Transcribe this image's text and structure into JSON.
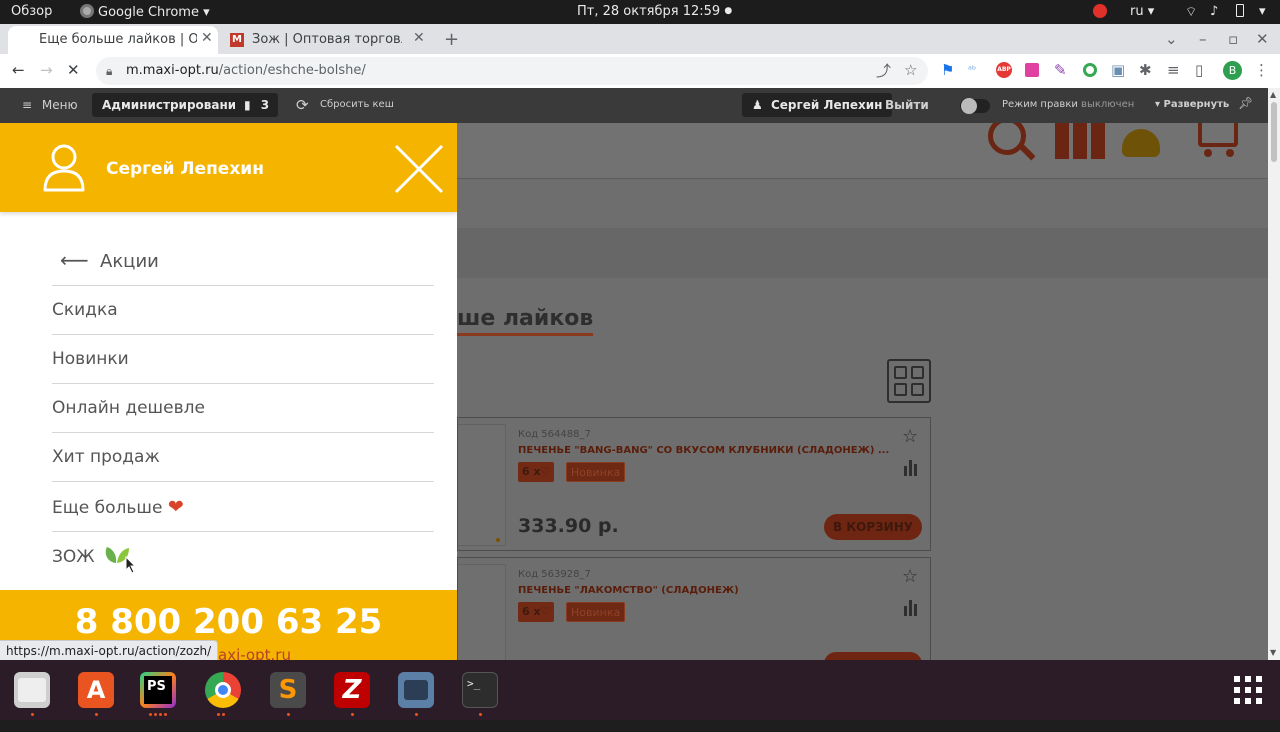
{
  "system": {
    "overview": "Обзор",
    "app": "Google Chrome",
    "datetime": "Пт, 28 октября  12:59",
    "lang": "ru"
  },
  "browser": {
    "tabs": [
      {
        "title": "Еще больше лайков | Оп"
      },
      {
        "title": "Зож | Оптовая торговля"
      }
    ],
    "url_host": "m.maxi-opt.ru",
    "url_path": "/action/eshche-bolshe/",
    "profile_initial": "В"
  },
  "admin": {
    "menu_label": "Меню",
    "administration_label": "Администрирование",
    "notifications_count": "3",
    "reset_cache_label": "Сбросить кеш",
    "user_label": "Сергей Лепехин",
    "logout_label": "Выйти",
    "edit_mode_label": "Режим правки",
    "edit_mode_state": "выключен",
    "expand_label": "Развернуть"
  },
  "page": {
    "title": "ше лайков",
    "products": [
      {
        "code": "Код 564488_7",
        "name": "ПЕЧЕНЬЕ \"BANG-BANG\" СО ВКУСОМ КЛУБНИКИ (СЛАДОНЕЖ) ...",
        "qty": "6 x",
        "badge": "Новинка",
        "price": "333.90 р.",
        "cart": "В КОРЗИНУ"
      },
      {
        "code": "Код 563928_7",
        "name": "ПЕЧЕНЬЕ \"ЛАКОМСТВО\" (СЛАДОНЕЖ)",
        "qty": "6 x",
        "badge": "Новинка",
        "price": "",
        "cart": ""
      }
    ]
  },
  "drawer": {
    "username": "Сергей Лепехин",
    "back_label": "Акции",
    "items": [
      {
        "label": "Скидка"
      },
      {
        "label": "Новинки"
      },
      {
        "label": "Онлайн дешевле"
      },
      {
        "label": "Хит продаж"
      },
      {
        "label": "Еще больше"
      },
      {
        "label": "ЗОЖ"
      }
    ],
    "phone": "8 800 200 63 25",
    "site": "axi-opt.ru"
  },
  "status_url": "https://m.maxi-opt.ru/action/zozh/",
  "colors": {
    "accent": "#f4b400",
    "brand_red": "#d2502a",
    "heart": "#d9452b",
    "leaf": "#6ab04c"
  }
}
